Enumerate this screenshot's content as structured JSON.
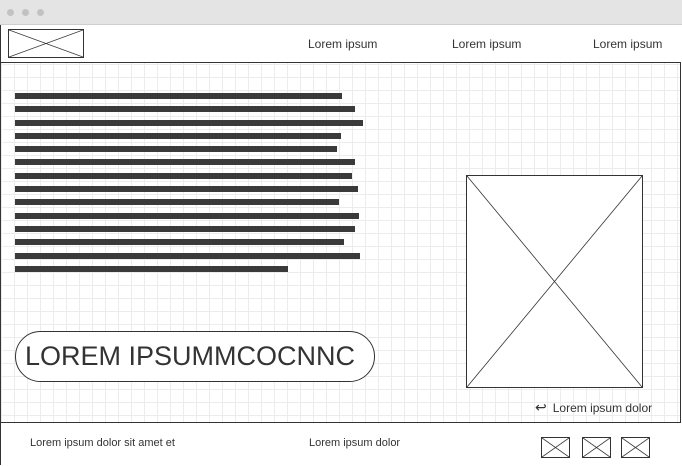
{
  "header": {
    "nav": [
      "Lorem ipsum",
      "Lorem ipsum",
      "Lorem ipsum"
    ]
  },
  "main": {
    "button_label": "LOREM IPSUMMCOCNNC",
    "back_link": {
      "arrow": "↩",
      "label": "Lorem ipsum dolor"
    }
  },
  "footer": {
    "text_left": "Lorem ipsum dolor sit amet et",
    "text_center": "Lorem ipsum dolor"
  },
  "colors": {
    "stroke": "#333333",
    "grid": "#ececec",
    "text_bar": "#3a3a3a"
  }
}
